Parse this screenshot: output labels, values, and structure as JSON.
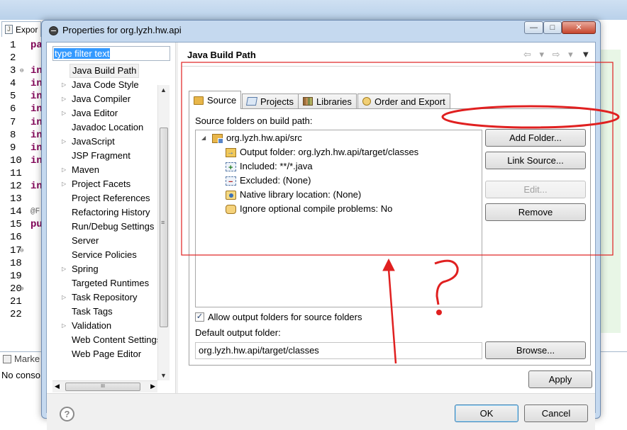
{
  "ide": {
    "tab_label": "Expor",
    "line_numbers": [
      "1",
      "2",
      "3",
      "4",
      "5",
      "6",
      "7",
      "8",
      "9",
      "10",
      "11",
      "12",
      "13",
      "14",
      "15",
      "16",
      "17",
      "18",
      "19",
      "20",
      "21",
      "22"
    ],
    "code_fragments": [
      "pa",
      "",
      "in",
      "in",
      "in",
      "in",
      "in",
      "in",
      "in",
      "in",
      "",
      "in",
      "",
      "@F",
      "pu",
      "",
      "",
      "",
      "",
      "",
      "",
      ""
    ],
    "markers_tab": "Marke",
    "console_message": "No conso"
  },
  "dialog": {
    "title": "Properties for org.lyzh.hw.api",
    "min_glyph": "—",
    "max_glyph": "□",
    "close_glyph": "✕"
  },
  "nav": {
    "filter_text": "type filter text",
    "items": [
      {
        "label": "Java Build Path",
        "arrow": ""
      },
      {
        "label": "Java Code Style",
        "arrow": "▷"
      },
      {
        "label": "Java Compiler",
        "arrow": "▷"
      },
      {
        "label": "Java Editor",
        "arrow": "▷"
      },
      {
        "label": "Javadoc Location",
        "arrow": ""
      },
      {
        "label": "JavaScript",
        "arrow": "▷"
      },
      {
        "label": "JSP Fragment",
        "arrow": ""
      },
      {
        "label": "Maven",
        "arrow": "▷"
      },
      {
        "label": "Project Facets",
        "arrow": "▷"
      },
      {
        "label": "Project References",
        "arrow": ""
      },
      {
        "label": "Refactoring History",
        "arrow": ""
      },
      {
        "label": "Run/Debug Settings",
        "arrow": ""
      },
      {
        "label": "Server",
        "arrow": ""
      },
      {
        "label": "Service Policies",
        "arrow": ""
      },
      {
        "label": "Spring",
        "arrow": "▷"
      },
      {
        "label": "Targeted Runtimes",
        "arrow": ""
      },
      {
        "label": "Task Repository",
        "arrow": "▷"
      },
      {
        "label": "Task Tags",
        "arrow": ""
      },
      {
        "label": "Validation",
        "arrow": "▷"
      },
      {
        "label": "Web Content Settings",
        "arrow": ""
      },
      {
        "label": "Web Page Editor",
        "arrow": ""
      }
    ],
    "scroll_up": "▲",
    "scroll_down": "▼",
    "scroll_left": "◀",
    "scroll_right": "▶",
    "grip_v": "≡",
    "grip_h": "III"
  },
  "page": {
    "title": "Java Build Path",
    "nav_back": "⇦ ▾",
    "nav_forward": "⇨ ▾",
    "view_menu": "▼",
    "tabs": [
      {
        "label": "Source",
        "icon": "folder-icon"
      },
      {
        "label": "Projects",
        "icon": "project-icon"
      },
      {
        "label": "Libraries",
        "icon": "libraries-icon"
      },
      {
        "label": "Order and Export",
        "icon": "order-icon"
      }
    ],
    "source_folders_label": "Source folders on build path:",
    "tree": {
      "root": "org.lyzh.hw.api/src",
      "root_toggle": "◢",
      "children": [
        "Output folder: org.lyzh.hw.api/target/classes",
        "Included: **/*.java",
        "Excluded: (None)",
        "Native library location: (None)",
        "Ignore optional compile problems: No"
      ]
    },
    "buttons": {
      "add_folder": "Add Folder...",
      "link_source": "Link Source...",
      "edit": "Edit...",
      "remove": "Remove",
      "browse": "Browse..."
    },
    "allow_output_label": "Allow output folders for source folders",
    "allow_output_checked": "✓",
    "default_output_label": "Default output folder:",
    "default_output_value": "org.lyzh.hw.api/target/classes"
  },
  "footer": {
    "help": "?",
    "apply": "Apply",
    "ok": "OK",
    "cancel": "Cancel"
  },
  "annotation": {
    "color": "#e02020",
    "question_mark": "?"
  }
}
